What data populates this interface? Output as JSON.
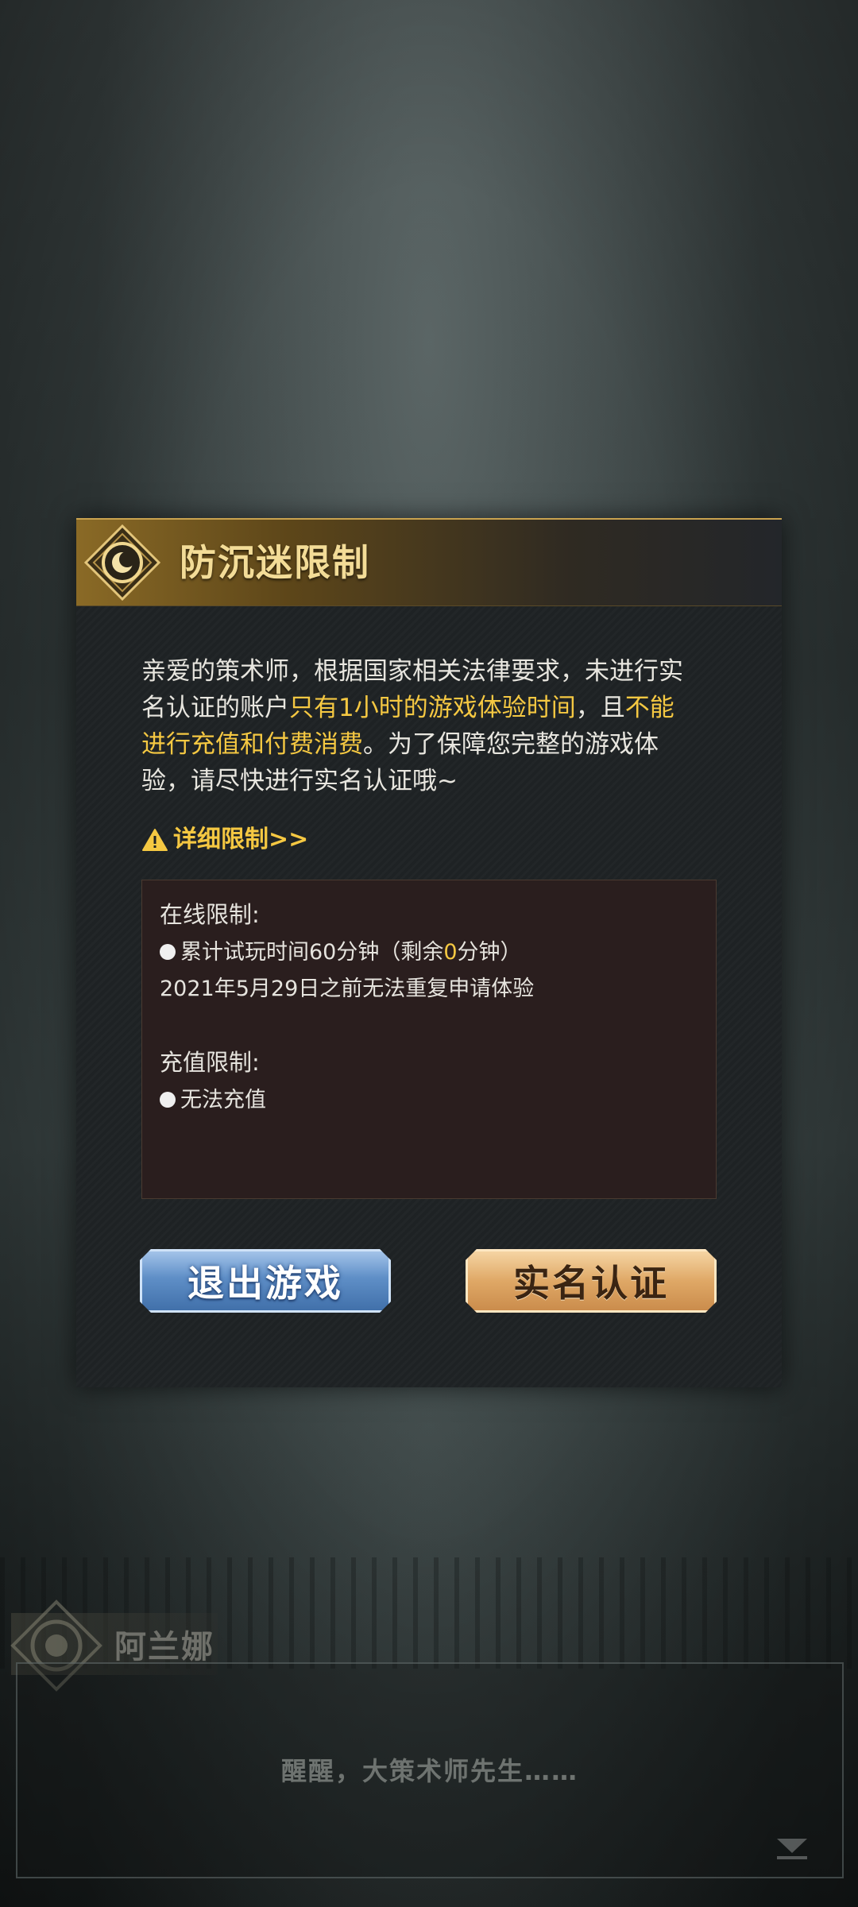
{
  "background": {
    "speaker_name": "阿兰娜",
    "dialogue_line": "醒醒，大策术师先生……"
  },
  "dialog": {
    "title": "防沉迷限制",
    "message": {
      "part1": "亲爱的策术师，根据国家相关法律要求，未进行实名认证的账户",
      "highlight1": "只有1小时的游戏体验时间",
      "part2": "，且",
      "highlight2": "不能进行充值和付费消费",
      "part3": "。为了保障您完整的游戏体验，请尽快进行实名认证哦~"
    },
    "detail_link": "详细限制>>",
    "info": {
      "online_title": "在线限制:",
      "online_item_prefix": "累计试玩时间60分钟（剩余",
      "online_remaining": "0",
      "online_item_suffix": "分钟）",
      "online_note": "2021年5月29日之前无法重复申请体验",
      "recharge_title": "充值限制:",
      "recharge_item": "无法充值"
    },
    "buttons": {
      "exit": "退出游戏",
      "verify": "实名认证"
    }
  },
  "colors": {
    "highlight": "#f5c842",
    "title": "#f3dc97",
    "exit_button": "#5f8fc7",
    "verify_button": "#dfa866"
  },
  "icons": [
    "emblem-icon",
    "warning-icon",
    "next-arrow-icon"
  ]
}
